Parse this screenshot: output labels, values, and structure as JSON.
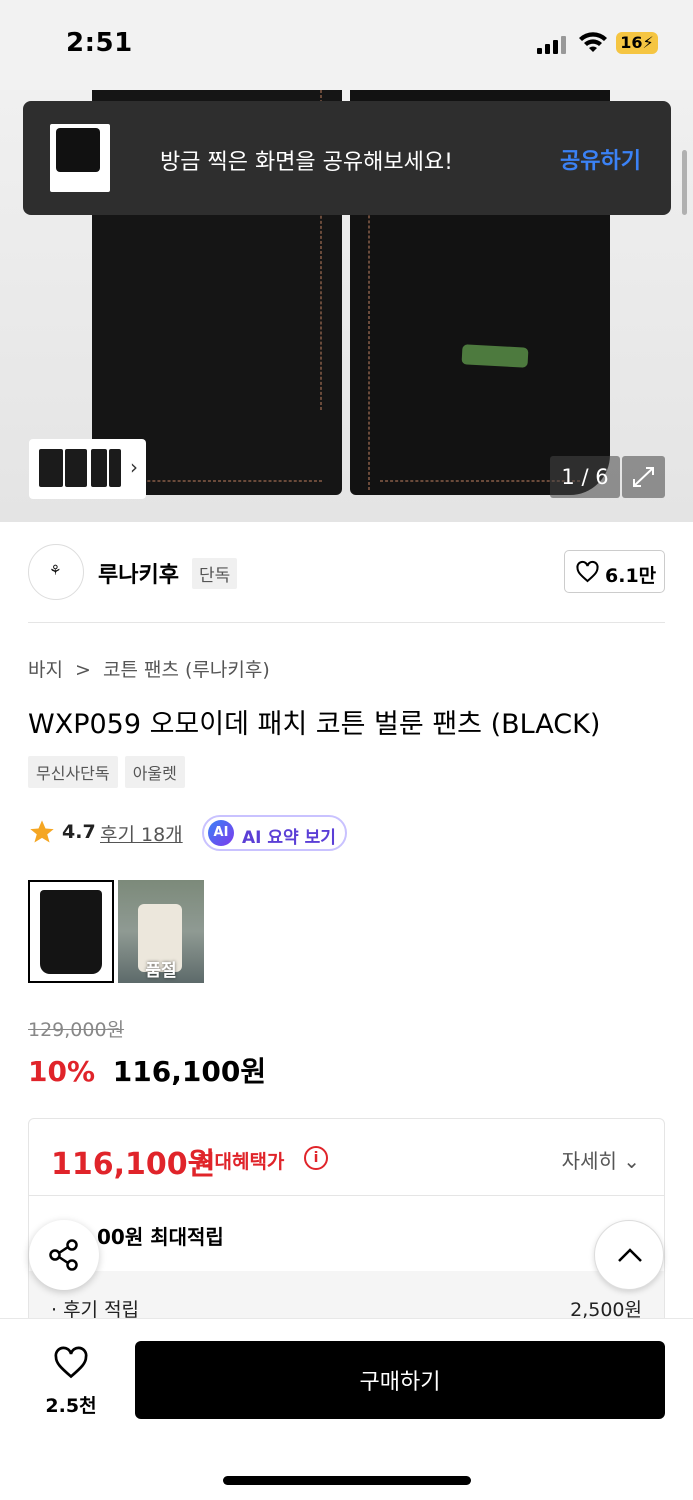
{
  "status_bar": {
    "time": "2:51",
    "battery": "16"
  },
  "toast": {
    "message": "방금 찍은 화면을 공유해보세요!",
    "action": "공유하기"
  },
  "hero": {
    "page_counter": "1 / 6"
  },
  "brand": {
    "name": "루나키후",
    "badge": "단독",
    "likes": "6.1만"
  },
  "breadcrumb": {
    "category": "바지",
    "separator": ">",
    "subcategory": "코튼 팬츠 (루나키후)"
  },
  "product": {
    "title": "WXP059 오모이데 패치 코튼 벌룬 팬츠 (BLACK)",
    "tags": [
      "무신사단독",
      "아울렛"
    ],
    "rating": "4.7",
    "reviews": "후기 18개",
    "ai_summary": "AI 요약 보기",
    "ai_badge": "AI"
  },
  "variants": [
    {
      "name": "black",
      "status": ""
    },
    {
      "name": "ivory",
      "status": "품절"
    }
  ],
  "price": {
    "original": "129,000원",
    "discount": "10%",
    "sale": "116,100원"
  },
  "benefit": {
    "max_price": "116,100원",
    "label": "최대혜택가",
    "detail": "자세히",
    "points": "00원 최대적립",
    "review_points_label": "· 후기 적립",
    "review_points_value": "2,500원"
  },
  "bottom_bar": {
    "wish_count": "2.5천",
    "buy_label": "구매하기"
  },
  "colors": {
    "accent_red": "#e0242a",
    "link_blue": "#3b82f6",
    "ai_purple": "#5b3fd6"
  }
}
